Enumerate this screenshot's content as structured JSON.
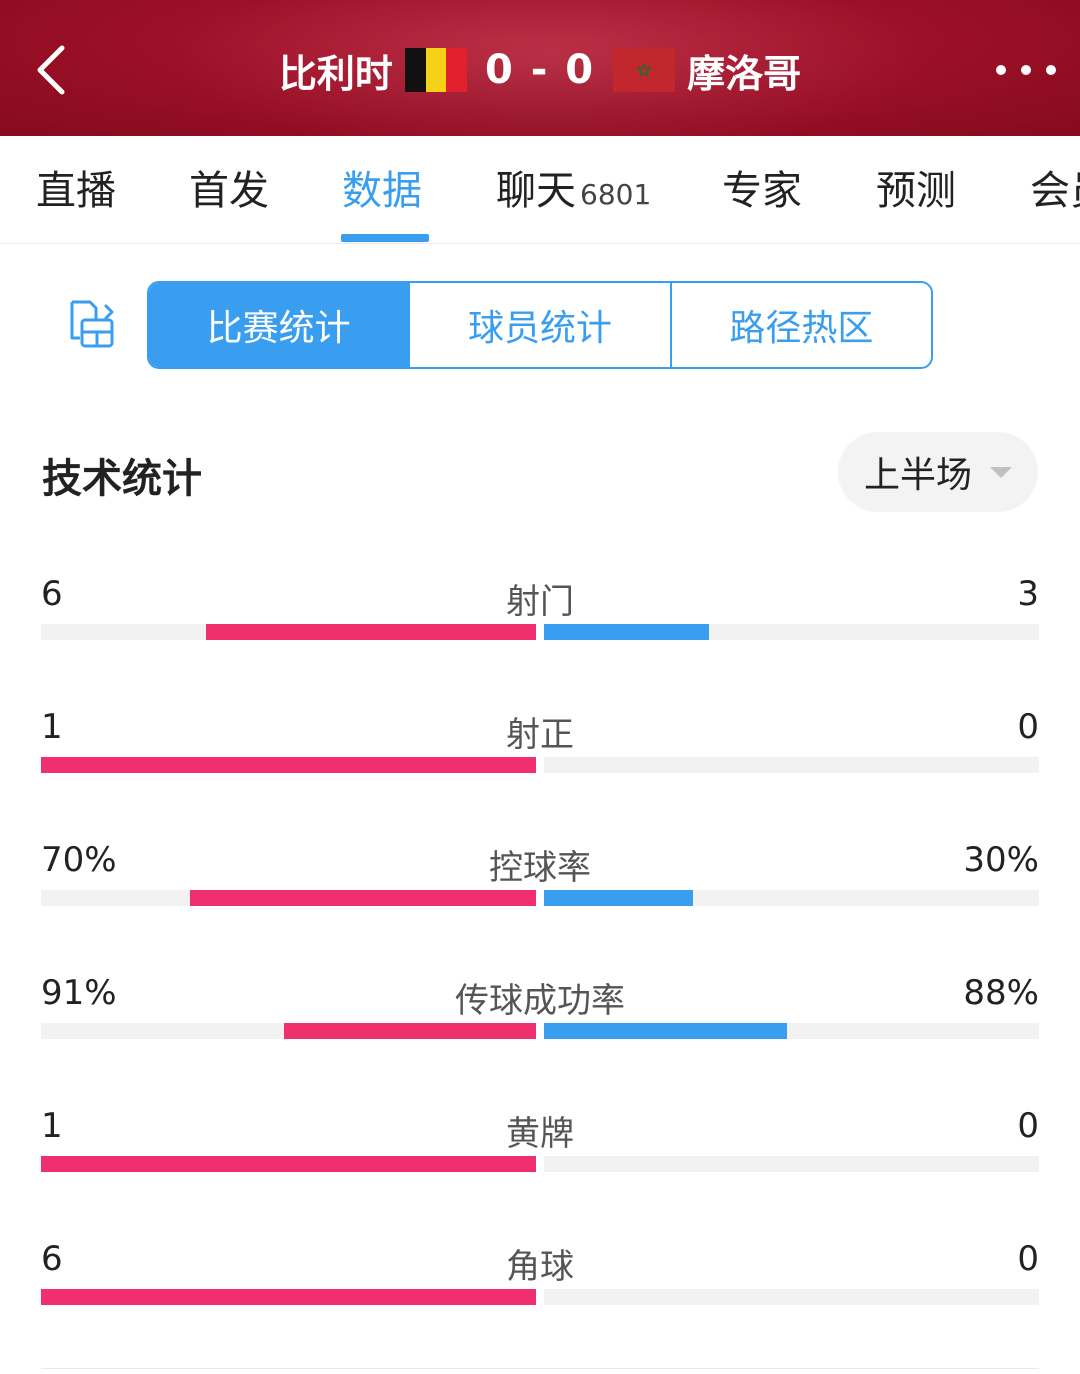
{
  "header": {
    "home_team": "比利时",
    "away_team": "摩洛哥",
    "score": "0 - 0",
    "back_icon": "chevron-left-icon",
    "more_icon": "more-dots-icon",
    "home_flag_colors": [
      "#111111",
      "#f5d118",
      "#e3202e"
    ],
    "away_flag_colors": [
      "#c1272d",
      "#1f6b35"
    ]
  },
  "tabs": [
    {
      "label": "直播",
      "badge": ""
    },
    {
      "label": "首发",
      "badge": ""
    },
    {
      "label": "数据",
      "badge": "",
      "active": true
    },
    {
      "label": "聊天",
      "badge": "6801"
    },
    {
      "label": "专家",
      "badge": ""
    },
    {
      "label": "预测",
      "badge": ""
    },
    {
      "label": "会员",
      "badge": ""
    }
  ],
  "segment": {
    "icon": "layout-switch-icon",
    "items": [
      "比赛统计",
      "球员统计",
      "路径热区"
    ],
    "active_index": 0
  },
  "section": {
    "title": "技术统计",
    "period": "上半场"
  },
  "colors": {
    "accent": "#3a9ef0",
    "home_bar": "#f0306e",
    "away_bar": "#3a9ef0",
    "track": "#f2f2f2"
  },
  "stats": [
    {
      "label": "射门",
      "home": "6",
      "away": "3",
      "home_ratio": 0.6667,
      "away_ratio": 0.3333
    },
    {
      "label": "射正",
      "home": "1",
      "away": "0",
      "home_ratio": 1.0,
      "away_ratio": 0.0
    },
    {
      "label": "控球率",
      "home": "70%",
      "away": "30%",
      "home_ratio": 0.7,
      "away_ratio": 0.3
    },
    {
      "label": "传球成功率",
      "home": "91%",
      "away": "88%",
      "home_ratio": 0.51,
      "away_ratio": 0.49
    },
    {
      "label": "黄牌",
      "home": "1",
      "away": "0",
      "home_ratio": 1.0,
      "away_ratio": 0.0
    },
    {
      "label": "角球",
      "home": "6",
      "away": "0",
      "home_ratio": 1.0,
      "away_ratio": 0.0
    }
  ]
}
